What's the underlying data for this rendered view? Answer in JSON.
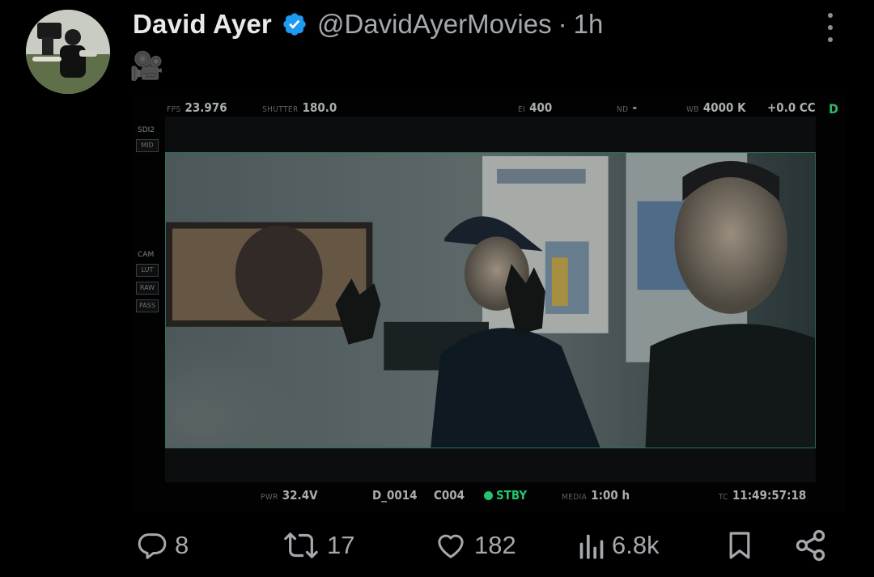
{
  "tweet": {
    "author": {
      "display_name": "David Ayer",
      "handle": "@DavidAyerMovies",
      "verified": true
    },
    "separator": "·",
    "time": "1h",
    "text": "🎥",
    "more_icon": "more-vertical-icon"
  },
  "media": {
    "hud_top": {
      "fps_label": "FPS",
      "fps_value": "23.976",
      "shutter_label": "SHUTTER",
      "shutter_value": "180.0",
      "ei_label": "EI",
      "ei_value": "400",
      "nd_label": "ND",
      "nd_value": "-",
      "wb_label": "WB",
      "wb_value": "4000 K",
      "tint_value": "+0.0 CC",
      "d_label": "D"
    },
    "hud_side": {
      "sdi_label": "SDI2",
      "sdi_box": "MID",
      "cam_label": "CAM",
      "cam_boxes": [
        "LUT",
        "RAW",
        "PASS"
      ]
    },
    "hud_bottom": {
      "pwr_label": "PWR",
      "pwr_value": "32.4V",
      "clip_value": "D_0014",
      "cam_value": "C004",
      "status_value": "STBY",
      "media_label": "MEDIA",
      "media_value": "1:00 h",
      "tc_label": "TC",
      "tc_value": "11:49:57:18"
    }
  },
  "actions": {
    "reply": {
      "icon": "reply-icon",
      "count": "8"
    },
    "repost": {
      "icon": "repost-icon",
      "count": "17"
    },
    "like": {
      "icon": "like-icon",
      "count": "182"
    },
    "views": {
      "icon": "views-icon",
      "count": "6.8k"
    },
    "bookmark": {
      "icon": "bookmark-icon"
    },
    "share": {
      "icon": "share-icon"
    }
  },
  "colors": {
    "background": "#000000",
    "text_primary": "#e7e9ea",
    "text_secondary": "#a5a9ad",
    "verified_blue": "#1d9bf0",
    "hud_green": "#25c46f"
  }
}
